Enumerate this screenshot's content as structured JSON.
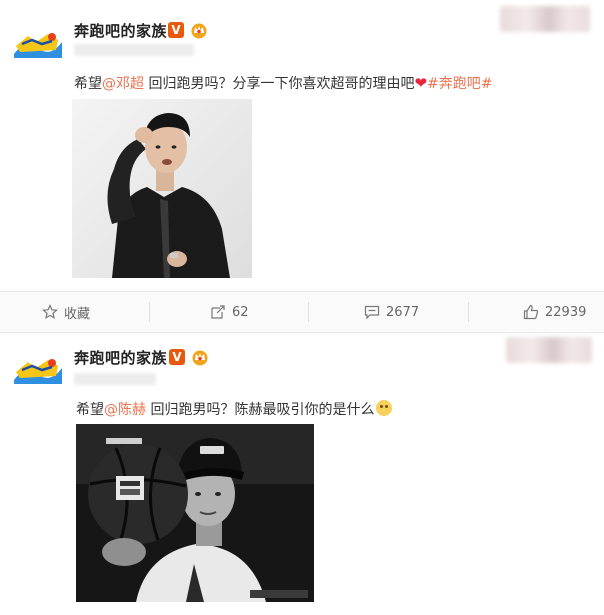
{
  "posts": [
    {
      "author": "奔跑吧的家族",
      "verified_mark": "V",
      "avatar_icon": "running-man-logo-icon",
      "badge_icon": "crown-badge-icon",
      "content": {
        "prefix": "希望",
        "mention": "@邓超",
        "middle": " 回归跑男吗？分享一下你喜欢超哥的理由吧",
        "heart": "❤",
        "topic": "#奔跑吧#"
      },
      "image_icon": "portrait-photo-icon"
    },
    {
      "author": "奔跑吧的家族",
      "verified_mark": "V",
      "avatar_icon": "running-man-logo-icon",
      "badge_icon": "crown-badge-icon",
      "content": {
        "prefix": "希望",
        "mention": "@陈赫",
        "middle": " 回归跑男吗？陈赫最吸引你的是什么",
        "emoji_icon": "wink-emoji-icon"
      },
      "image_icon": "basketball-portrait-photo-icon"
    }
  ],
  "actions": {
    "favorite": {
      "label": "收藏",
      "icon": "star-icon"
    },
    "repost": {
      "count": "62",
      "icon": "repost-icon"
    },
    "comment": {
      "count": "2677",
      "icon": "comment-icon"
    },
    "like": {
      "count": "22939",
      "icon": "thumbs-up-icon"
    }
  },
  "colors": {
    "mention": "#eb7350",
    "verified": "#e8590c",
    "heart": "#e8243e"
  }
}
